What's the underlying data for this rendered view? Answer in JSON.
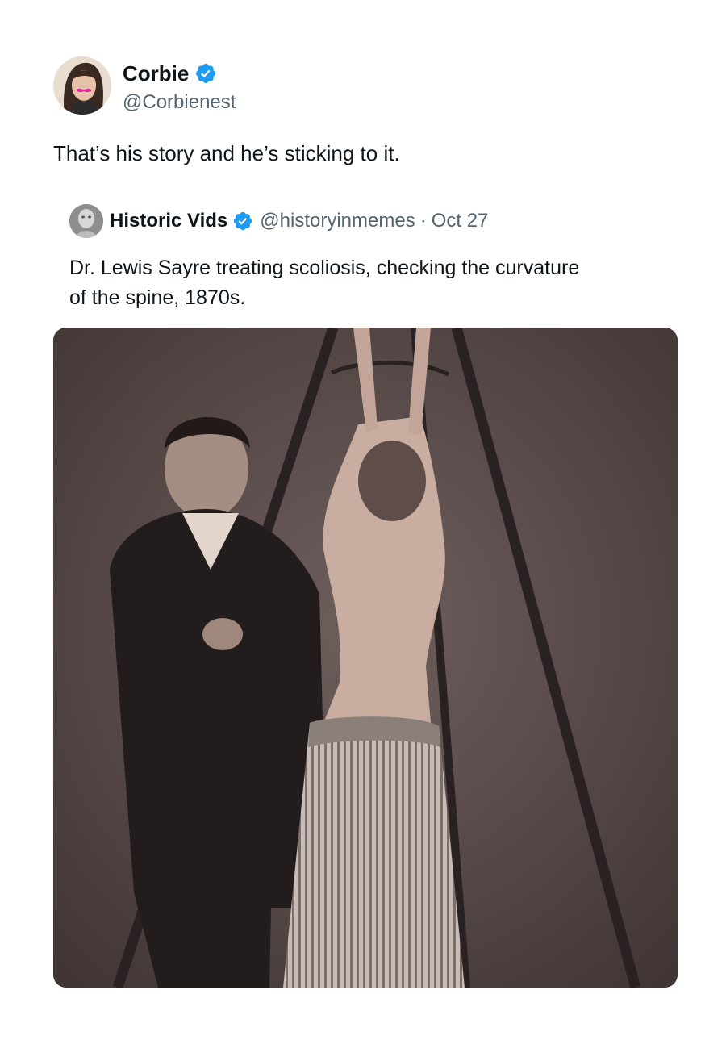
{
  "tweet": {
    "author": {
      "display_name": "Corbie",
      "handle": "@Corbienest",
      "verified": true,
      "avatar_icon": "avatar-photo"
    },
    "text": "That’s his story and he’s sticking to it."
  },
  "quoted_tweet": {
    "author": {
      "display_name": "Historic Vids",
      "handle": "@historyinmemes",
      "verified": true,
      "avatar_icon": "avatar-photo"
    },
    "separator": "·",
    "date": "Oct 27",
    "text": "Dr. Lewis Sayre treating scoliosis, checking the curvature of the spine, 1870s.",
    "media_icon": "sepia-photo"
  },
  "colors": {
    "verified_badge": "#1d9bf0",
    "secondary_text": "#536471",
    "primary_text": "#0f1419",
    "photo_background": "#5a4c4b"
  }
}
